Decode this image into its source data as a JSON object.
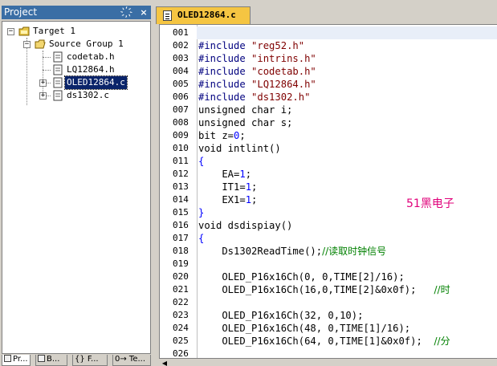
{
  "project_panel": {
    "title": "Project",
    "pin_glyph": "҉",
    "close_glyph": "×",
    "tree": {
      "target": "Target 1",
      "group": "Source Group 1",
      "files": [
        "codetab.h",
        "LQ12864.h",
        "OLED12864.c",
        "ds1302.c"
      ],
      "selected_file": "OLED12864.c"
    },
    "bottom_tabs": [
      "Pr...",
      "B...",
      "{} F...",
      "0→ Te..."
    ]
  },
  "editor": {
    "tab_title": "OLED12864.c",
    "line_numbers": [
      "001",
      "002",
      "003",
      "004",
      "005",
      "006",
      "007",
      "008",
      "009",
      "010",
      "011",
      "012",
      "013",
      "014",
      "015",
      "016",
      "017",
      "018",
      "019",
      "020",
      "021",
      "022",
      "023",
      "024",
      "025",
      "026"
    ],
    "lines": {
      "l2": {
        "kw": "#include",
        "str": "\"reg52.h\""
      },
      "l3": {
        "kw": "#include",
        "str": "\"intrins.h\""
      },
      "l4": {
        "kw": "#include",
        "str": "\"codetab.h\""
      },
      "l5": {
        "kw": "#include",
        "str": "\"LQ12864.h\""
      },
      "l6": {
        "kw": "#include",
        "str": "\"ds1302.h\""
      },
      "l7": "unsigned char i;",
      "l8": "unsigned char s;",
      "l9_a": "bit z=",
      "l9_n": "0",
      "l9_b": ";",
      "l10": "void intlint()",
      "l11": "{",
      "l12_a": "    EA=",
      "l12_n": "1",
      "l12_b": ";",
      "l13_a": "    IT1=",
      "l13_n": "1",
      "l13_b": ";",
      "l14_a": "    EX1=",
      "l14_n": "1",
      "l14_b": ";",
      "l15": "}",
      "l16": "void dsdispiay()",
      "l17": "{",
      "l18_code": "    Ds1302ReadTime();",
      "l18_cmt": "//读取时钟信号",
      "l20": "    OLED_P16x16Ch(0, 0,TIME[2]/16);",
      "l21_code": "    OLED_P16x16Ch(16,0,TIME[2]&0x0f);   ",
      "l21_cmt": "//时",
      "l23": "    OLED_P16x16Ch(32, 0,10);",
      "l24": "    OLED_P16x16Ch(48, 0,TIME[1]/16);",
      "l25_code": "    OLED_P16x16Ch(64, 0,TIME[1]&0x0f);  ",
      "l25_cmt": "//分"
    },
    "watermark": "51黑电子"
  }
}
